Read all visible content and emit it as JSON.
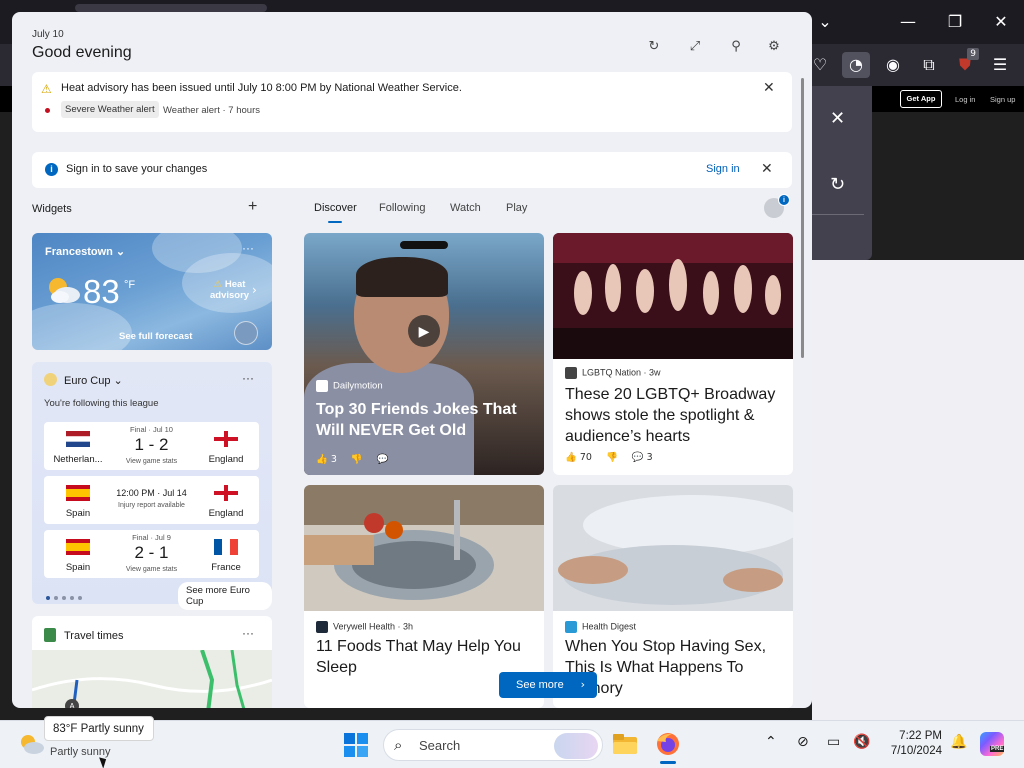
{
  "browser": {
    "get_app": "Get App",
    "log_in": "Log in",
    "sign_up": "Sign up",
    "extension_badge": "9",
    "window_controls": [
      "chevron-down-icon",
      "minimize-icon",
      "restore-icon",
      "close-icon"
    ]
  },
  "panel": {
    "date": "July 10",
    "greeting": "Good evening",
    "header_icons": [
      "refresh-icon",
      "expand-icon",
      "pin-icon",
      "settings-icon"
    ]
  },
  "alert": {
    "text": "Heat advisory has been issued until July 10 8:00 PM by National Weather Service.",
    "tag": "Severe Weather alert",
    "meta": "Weather alert · 7 hours"
  },
  "signin": {
    "text": "Sign in to save your changes",
    "link": "Sign in"
  },
  "widgets": {
    "title": "Widgets",
    "add": "+"
  },
  "tabs": [
    {
      "label": "Discover",
      "active": true
    },
    {
      "label": "Following",
      "active": false
    },
    {
      "label": "Watch",
      "active": false
    },
    {
      "label": "Play",
      "active": false
    }
  ],
  "weather": {
    "location": "Francestown",
    "temp": "83",
    "unit": "°F",
    "alert_line1": "Heat",
    "alert_line2": "advisory",
    "forecast_link": "See full forecast"
  },
  "euro": {
    "title": "Euro Cup",
    "subtitle": "You're following this league",
    "see_more": "See more Euro Cup",
    "matches": [
      {
        "home": "Netherlan...",
        "away": "England",
        "top": "Final · Jul 10",
        "score": "1 - 2",
        "sub": "View game stats",
        "home_flag": "nl",
        "away_flag": "en"
      },
      {
        "home": "Spain",
        "away": "England",
        "top": "",
        "mid": "12:00 PM · Jul 14",
        "sub": "Injury report available",
        "home_flag": "es",
        "away_flag": "en"
      },
      {
        "home": "Spain",
        "away": "France",
        "top": "Final · Jul 9",
        "score": "2 - 1",
        "sub": "View game stats",
        "home_flag": "es",
        "away_flag": "fr"
      }
    ]
  },
  "travel": {
    "title": "Travel times"
  },
  "news": [
    {
      "source": "Dailymotion",
      "headline": "Top 30 Friends Jokes That Will NEVER Get Old",
      "likes": "3",
      "comments": ""
    },
    {
      "source": "LGBTQ Nation · 3w",
      "headline": "These 20 LGBTQ+ Broadway shows stole the spotlight & audience’s hearts",
      "likes": "70",
      "comments": "3"
    },
    {
      "source": "Verywell Health · 3h",
      "headline": "11 Foods That May Help You Sleep"
    },
    {
      "source": "Health Digest",
      "headline": "When You Stop Having Sex, This Is What Happens To Memory"
    }
  ],
  "see_more": "See more",
  "taskbar": {
    "tooltip": "83°F Partly sunny",
    "condition": "Partly sunny",
    "search_placeholder": "Search",
    "time": "7:22 PM",
    "date": "7/10/2024",
    "copilot_badge": "PRE"
  },
  "colors": {
    "accent": "#0067c0",
    "panel_bg": "#eef0f5",
    "alert_red": "#c50f1f"
  }
}
